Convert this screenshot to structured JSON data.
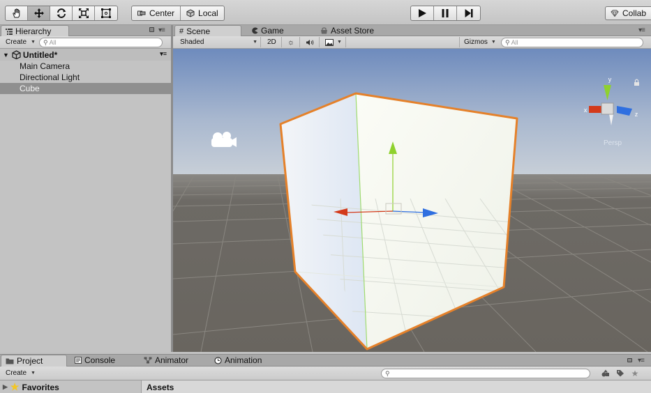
{
  "toolbar": {
    "tools": [
      {
        "name": "hand-tool",
        "icon": "hand-icon",
        "active": false
      },
      {
        "name": "move-tool",
        "icon": "move-icon",
        "active": true
      },
      {
        "name": "rotate-tool",
        "icon": "rotate-icon",
        "active": false
      },
      {
        "name": "scale-tool",
        "icon": "scale-icon",
        "active": false
      },
      {
        "name": "rect-tool",
        "icon": "rect-transform-icon",
        "active": false
      }
    ],
    "pivot_label": "Center",
    "space_label": "Local",
    "collab_label": "Collab"
  },
  "hierarchy": {
    "tab_label": "Hierarchy",
    "create_label": "Create",
    "search_placeholder": "All",
    "scene_name": "Untitled*",
    "items": [
      {
        "label": "Main Camera",
        "selected": false
      },
      {
        "label": "Directional Light",
        "selected": false
      },
      {
        "label": "Cube",
        "selected": true
      }
    ]
  },
  "scene_view": {
    "tabs": [
      {
        "label": "Scene",
        "icon": "grid-icon",
        "active": true
      },
      {
        "label": "Game",
        "icon": "pacman-icon",
        "active": false
      },
      {
        "label": "Asset Store",
        "icon": "store-icon",
        "active": false
      }
    ],
    "shading_mode": "Shaded",
    "toggle_2d_label": "2D",
    "gizmos_label": "Gizmos",
    "search_placeholder": "All",
    "orientation_axes": {
      "x": "x",
      "y": "y",
      "z": "z"
    },
    "projection_label": "Persp",
    "colors": {
      "sky_top": "#6e8bbd",
      "horizon": "#c9d0d8",
      "ground": "#69655f",
      "selection_outline": "#e5812a",
      "axis_x": "#d33a1b",
      "axis_y": "#8fd12e",
      "axis_z": "#2f6fe0"
    }
  },
  "project_panel": {
    "tabs": [
      {
        "label": "Project",
        "icon": "folder-icon",
        "active": true
      },
      {
        "label": "Console",
        "icon": "console-icon",
        "active": false
      },
      {
        "label": "Animator",
        "icon": "animator-icon",
        "active": false
      },
      {
        "label": "Animation",
        "icon": "clock-icon",
        "active": false
      }
    ],
    "create_label": "Create",
    "favorites_label": "Favorites",
    "assets_label": "Assets"
  }
}
